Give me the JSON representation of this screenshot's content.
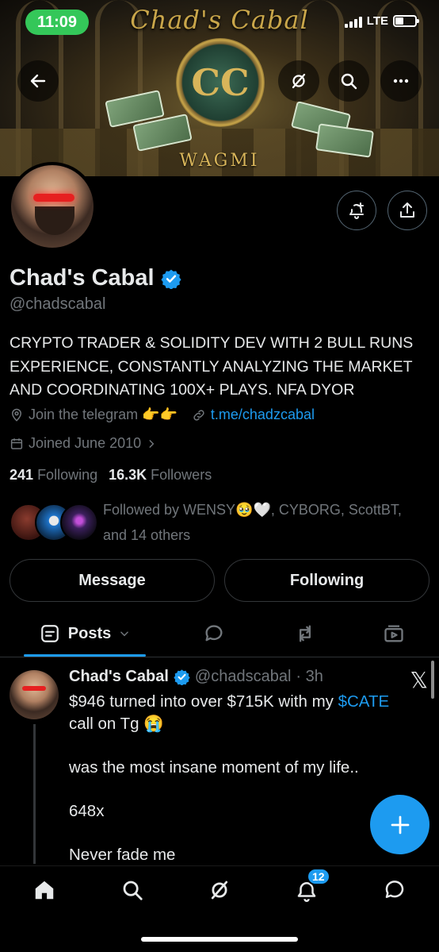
{
  "status_bar": {
    "time": "11:09",
    "network": "LTE"
  },
  "banner": {
    "title": "Chad's Cabal",
    "seal": "CC",
    "footer": "WAGMI"
  },
  "profile": {
    "name": "Chad's Cabal",
    "handle": "@chadscabal",
    "bio": "CRYPTO TRADER & SOLIDITY DEV WITH 2 BULL RUNS EXPERIENCE, CONSTANTLY ANALYZING THE MARKET AND COORDINATING 100X+ PLAYS. NFA DYOR",
    "location": "Join the telegram 👉👉",
    "website": "t.me/chadzcabal",
    "joined": "Joined June 2010",
    "following_count": "241",
    "following_label": "Following",
    "followers_count": "16.3K",
    "followers_label": "Followers",
    "followed_by_line1": "Followed by WENSY🥹🤍, CYBORG, ScottBT,",
    "followed_by_line2": "and 14 others"
  },
  "actions": {
    "message": "Message",
    "following": "Following"
  },
  "tabs": {
    "posts": "Posts"
  },
  "post": {
    "name": "Chad's Cabal",
    "handle": "@chadscabal",
    "time": "· 3h",
    "line1_prefix": "$946 turned into over $715K with my ",
    "cashtag": "$CATE",
    "line1_suffix": "call on Tg 😭",
    "line2": "was the most insane moment of my life..",
    "line3": "648x",
    "line4": "Never fade me"
  },
  "nav": {
    "notifications_badge": "12"
  },
  "colors": {
    "accent": "#1d9bf0",
    "background": "#000000",
    "secondary_text": "#71767b",
    "time_pill": "#34c759"
  }
}
